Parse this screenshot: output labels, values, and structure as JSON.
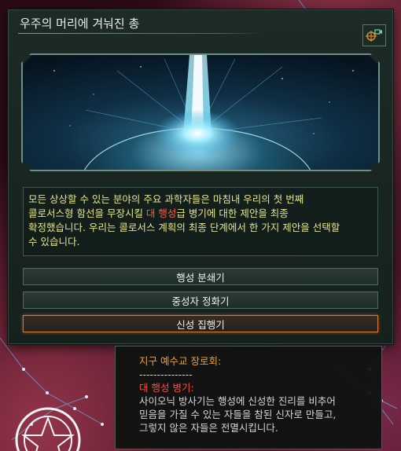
{
  "dialog": {
    "title": "우주의 머리에 겨눠진 총",
    "camera_icon": "camera-locate-icon",
    "banner_image": "colossus-energy-beam-over-planet",
    "description": {
      "line1": "모든 상상할 수 있는 분야의 주요 과학자들은 마침내 우리의 첫 번째",
      "line2_pre": "콜로서스형 함선을 무장시킬 ",
      "line2_highlight": "대 행성",
      "line2_post": "급 병기에 대한 제안을 최종",
      "line3": "확정했습니다. 우리는 콜로서스 계획의 최종 단계에서 한 가지 제안을 선택할",
      "line4": "수 있습니다."
    },
    "options": [
      {
        "label": "행성 분쇄기",
        "selected": false
      },
      {
        "label": "중성자 정화기",
        "selected": false
      },
      {
        "label": "신성 집행기",
        "selected": true
      }
    ]
  },
  "tooltip": {
    "author": "지구 예수교 장로회:",
    "separator": "---------------",
    "weapon_title": "대 행성 병기:",
    "body": [
      "사이오닉 방사기는 행성에 신성한 진리를 비추어",
      "믿음을 가질 수 있는 자들을 참된 신자로 만들고,",
      "그렇지 않은 자들은 전멸시킵니다."
    ]
  },
  "colors": {
    "description_text": "#e4e48c",
    "highlight": "#ff5a48",
    "selected_border": "#e07a2a",
    "tooltip_author": "#f0a030"
  }
}
